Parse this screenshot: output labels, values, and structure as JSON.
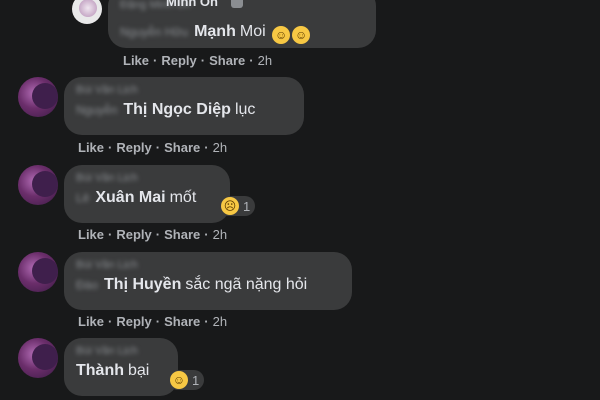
{
  "comments": [
    {
      "blurred_name": "Đặng Minh Ổn",
      "visible_name": "Minh Ổn",
      "blurred_tag": "Nguyễn Hữu",
      "tag_name": "Mạnh",
      "text": "Moi",
      "emoji": "😂😂",
      "actions": {
        "like": "Like",
        "reply": "Reply",
        "share": "Share",
        "time": "2h"
      }
    },
    {
      "blurred_name": "Bùi Văn Lịch",
      "blurred_tag": "Nguyễn",
      "tag_name": "Thị Ngọc Diệp",
      "text": "lục",
      "actions": {
        "like": "Like",
        "reply": "Reply",
        "share": "Share",
        "time": "2h"
      }
    },
    {
      "blurred_name": "Bùi Văn Lịch",
      "blurred_tag": "Lê",
      "tag_name": "Xuân Mai",
      "text": "mốt",
      "reaction": {
        "emoji": "😞",
        "count": "1"
      },
      "actions": {
        "like": "Like",
        "reply": "Reply",
        "share": "Share",
        "time": "2h"
      }
    },
    {
      "blurred_name": "Bùi Văn Lịch",
      "blurred_tag": "Đào",
      "tag_name": "Thị Huyền",
      "text": "sắc ngã nặng hỏi",
      "actions": {
        "like": "Like",
        "reply": "Reply",
        "share": "Share",
        "time": "2h"
      }
    },
    {
      "blurred_name": "Bùi Văn Lịch",
      "tag_name": "Thành",
      "text": "bại",
      "reaction": {
        "emoji": "😆",
        "count": "1"
      }
    }
  ],
  "colors": {
    "background": "#18191a",
    "bubble": "#3a3b3c",
    "text": "#e4e6eb",
    "muted": "#b0b3b8"
  }
}
